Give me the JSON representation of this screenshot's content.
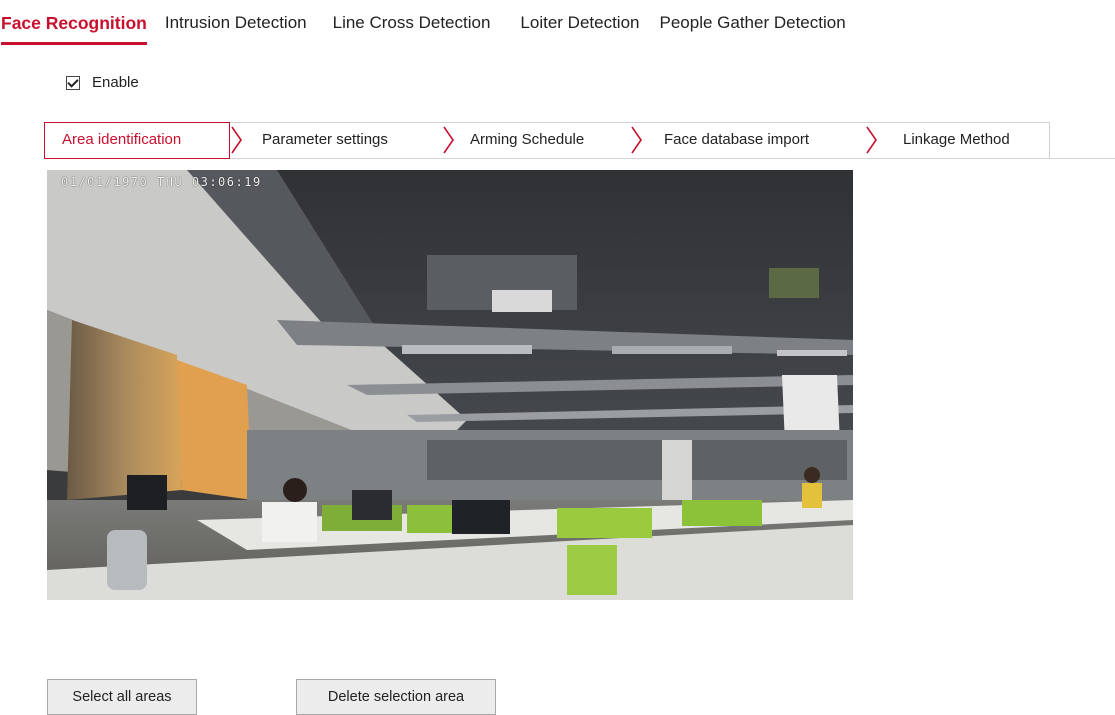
{
  "top_tabs": [
    {
      "label": "Face Recognition",
      "active": true
    },
    {
      "label": "Intrusion Detection",
      "active": false
    },
    {
      "label": "Line Cross Detection",
      "active": false
    },
    {
      "label": "Loiter Detection",
      "active": false
    },
    {
      "label": "People Gather Detection",
      "active": false
    }
  ],
  "enable": {
    "label": "Enable",
    "checked": true
  },
  "steps": [
    {
      "label": "Area identification",
      "active": true
    },
    {
      "label": "Parameter settings",
      "active": false
    },
    {
      "label": "Arming Schedule",
      "active": false
    },
    {
      "label": "Face database import",
      "active": false
    },
    {
      "label": "Linkage Method",
      "active": false
    }
  ],
  "video": {
    "osd_timestamp": "01/01/1970 THU 03:06:19"
  },
  "buttons": {
    "select_all": "Select all areas",
    "delete_selection": "Delete selection area"
  },
  "colors": {
    "accent": "#c8102e",
    "border": "#d0d0d0",
    "button_bg": "#ececec"
  }
}
